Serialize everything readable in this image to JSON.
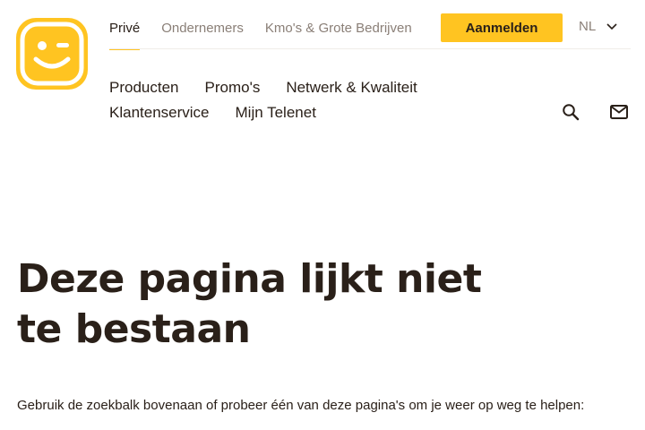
{
  "colors": {
    "brand_yellow": "#ffc421",
    "text_dark": "#2a2019",
    "text_muted": "#8a7f77"
  },
  "logo": {
    "icon": "telenet-smiley-logo-icon"
  },
  "segments": [
    {
      "label": "Privé",
      "active": true
    },
    {
      "label": "Ondernemers",
      "active": false
    },
    {
      "label": "Kmo's & Grote Bedrijven",
      "active": false
    }
  ],
  "header": {
    "login_label": "Aanmelden",
    "language": "NL"
  },
  "main_nav": {
    "row1": [
      "Producten",
      "Promo's",
      "Netwerk & Kwaliteit"
    ],
    "row2": [
      "Klantenservice",
      "Mijn Telenet"
    ]
  },
  "icons": {
    "search": "search-icon",
    "mail": "mail-icon",
    "chevron": "chevron-down-icon"
  },
  "page": {
    "title_line1": "Deze pagina lijkt niet",
    "title_line2": "te bestaan",
    "intro": "Gebruik de zoekbalk bovenaan of probeer één van deze pagina's om je weer op weg te helpen:"
  }
}
